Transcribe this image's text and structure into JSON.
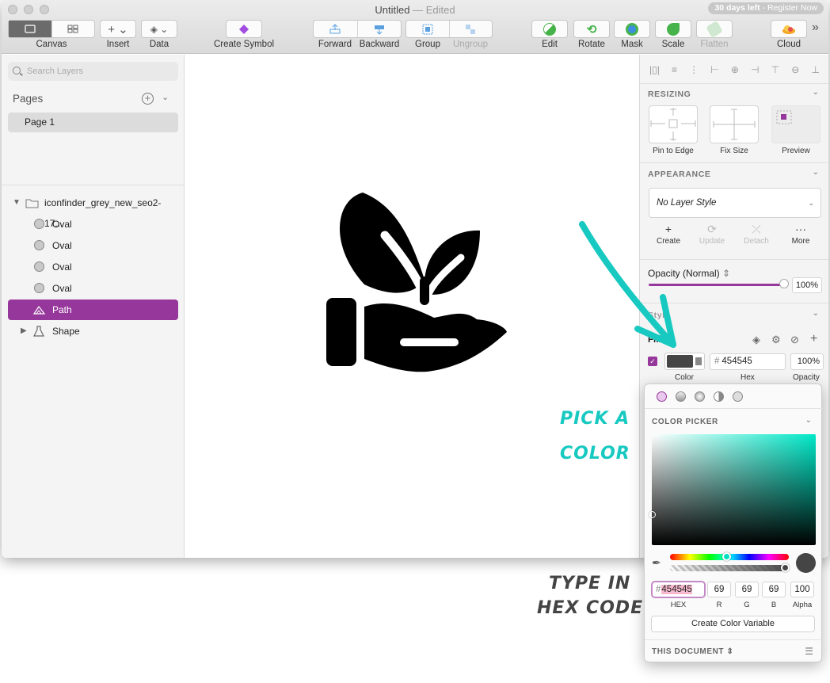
{
  "window": {
    "title": "Untitled",
    "edited_suffix": "— Edited",
    "trial": {
      "days": "30 days left",
      "register": "- Register Now"
    }
  },
  "toolbar": {
    "canvas": "Canvas",
    "insert": "Insert",
    "data": "Data",
    "create_symbol": "Create Symbol",
    "forward": "Forward",
    "backward": "Backward",
    "group": "Group",
    "ungroup": "Ungroup",
    "edit": "Edit",
    "rotate": "Rotate",
    "mask": "Mask",
    "scale": "Scale",
    "flatten": "Flatten",
    "cloud": "Cloud",
    "more": "»"
  },
  "left": {
    "search_placeholder": "Search Layers",
    "pages_title": "Pages",
    "pages": [
      "Page 1"
    ],
    "layers": [
      {
        "name": "iconfinder_grey_new_seo2-17...",
        "kind": "group"
      },
      {
        "name": "Oval",
        "kind": "oval"
      },
      {
        "name": "Oval",
        "kind": "oval"
      },
      {
        "name": "Oval",
        "kind": "oval"
      },
      {
        "name": "Oval",
        "kind": "oval"
      },
      {
        "name": "Path",
        "kind": "path",
        "selected": true
      },
      {
        "name": "Shape",
        "kind": "shape"
      }
    ]
  },
  "inspector": {
    "resizing": "RESIZING",
    "pin_to_edge": "Pin to Edge",
    "fix_size": "Fix Size",
    "preview": "Preview",
    "appearance": "APPEARANCE",
    "layer_style": "No Layer Style",
    "actions": [
      "Create",
      "Update",
      "Detach",
      "More"
    ],
    "opacity_label": "Opacity (Normal)",
    "opacity_value": "100%",
    "opacity_level": 1.0,
    "style_label": "Style",
    "fills_title": "Fills",
    "fill_hex": "454545",
    "fill_opacity": "100%",
    "fill_labels": {
      "color": "Color",
      "hex": "Hex",
      "opacity": "Opacity"
    }
  },
  "picker": {
    "title": "COLOR PICKER",
    "hex": "454545",
    "r": "69",
    "g": "69",
    "b": "69",
    "alpha": "100",
    "labels": {
      "hex": "HEX",
      "r": "R",
      "g": "G",
      "b": "B",
      "alpha": "Alpha"
    },
    "create_variable": "Create Color Variable",
    "document": "THIS DOCUMENT",
    "colors": {
      "selected": "#454545",
      "hue": "#00e8c8",
      "accent": "#96379b"
    }
  },
  "annotations": {
    "pick_line1": "PICK A",
    "pick_line2": "COLOR",
    "type_line1": "TYPE IN",
    "type_line2": "HEX CODE"
  }
}
